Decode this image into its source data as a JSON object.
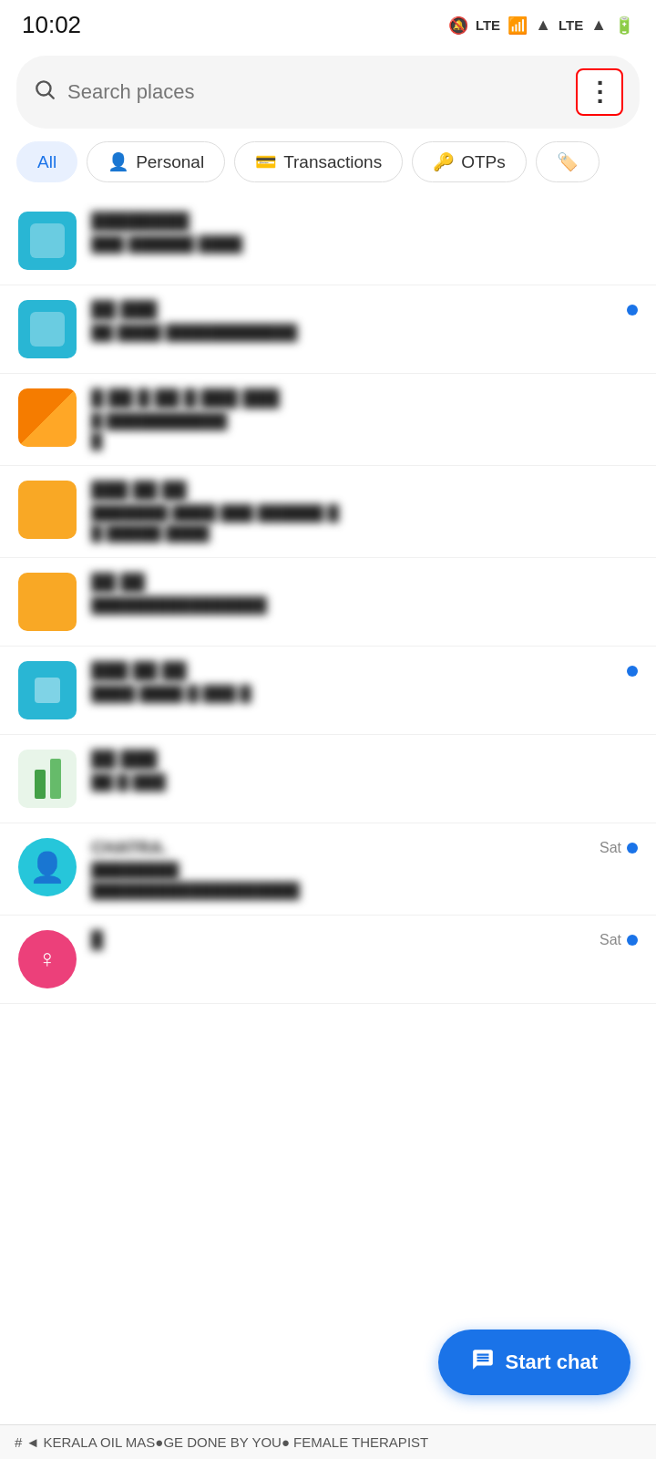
{
  "statusBar": {
    "time": "10:02",
    "icons": [
      "mute",
      "lte",
      "wifi",
      "signal",
      "lte2",
      "signal2",
      "battery"
    ]
  },
  "searchBar": {
    "placeholder": "Search places",
    "menuButtonLabel": "⋮"
  },
  "filterTabs": [
    {
      "id": "all",
      "label": "All",
      "icon": "",
      "active": true
    },
    {
      "id": "personal",
      "label": "Personal",
      "icon": "👤",
      "active": false
    },
    {
      "id": "transactions",
      "label": "Transactions",
      "icon": "💳",
      "active": false
    },
    {
      "id": "otps",
      "label": "OTPs",
      "icon": "🔑",
      "active": false
    },
    {
      "id": "labels",
      "label": "",
      "icon": "🏷️",
      "active": false
    }
  ],
  "messages": [
    {
      "id": 1,
      "avatarType": "square",
      "avatarColor": "cyan",
      "sender": "████████",
      "time": "",
      "preview": "███ ██████ ████",
      "hasUnread": false
    },
    {
      "id": 2,
      "avatarType": "square",
      "avatarColor": "cyan",
      "sender": "██ ███",
      "time": "",
      "preview": "██ ████ ████████",
      "hasUnread": true
    },
    {
      "id": 3,
      "avatarType": "square",
      "avatarColor": "orange",
      "sender": "█ ██ █ ██ █ ███ ███",
      "time": "",
      "preview": "█ ███████",
      "hasUnread": false
    },
    {
      "id": 4,
      "avatarType": "square",
      "avatarColor": "yellow",
      "sender": "███ ██ ██",
      "time": "",
      "preview": "███████ ████ ███ ██████ █",
      "preview2": "█ █████ ████",
      "hasUnread": false
    },
    {
      "id": 5,
      "avatarType": "square",
      "avatarColor": "yellow2",
      "sender": "██ ██",
      "time": "",
      "preview": "████████████████",
      "hasUnread": false
    },
    {
      "id": 6,
      "avatarType": "square",
      "avatarColor": "cyan2",
      "sender": "███ ██ ██",
      "time": "",
      "preview": "████ ████ █ ███ █",
      "hasUnread": true
    },
    {
      "id": 7,
      "avatarType": "bars",
      "avatarColor": "green",
      "sender": "██ ███",
      "time": "",
      "preview": "██ █ ███",
      "hasUnread": false
    },
    {
      "id": 8,
      "avatarType": "circle",
      "avatarColor": "teal",
      "sender": "CHATRA.",
      "time": "Sat",
      "preview": "████████",
      "preview2": "███████████████████",
      "hasUnread": true
    },
    {
      "id": 9,
      "avatarType": "circle",
      "avatarColor": "pink",
      "sender": "█",
      "time": "Sat",
      "preview": "",
      "hasUnread": true
    }
  ],
  "fab": {
    "label": "Start chat",
    "icon": "💬"
  },
  "bottomBar": {
    "text": "# ◄ KERALA OIL MAS●GE DONE BY YOU● FEMALE THERAPIST"
  }
}
